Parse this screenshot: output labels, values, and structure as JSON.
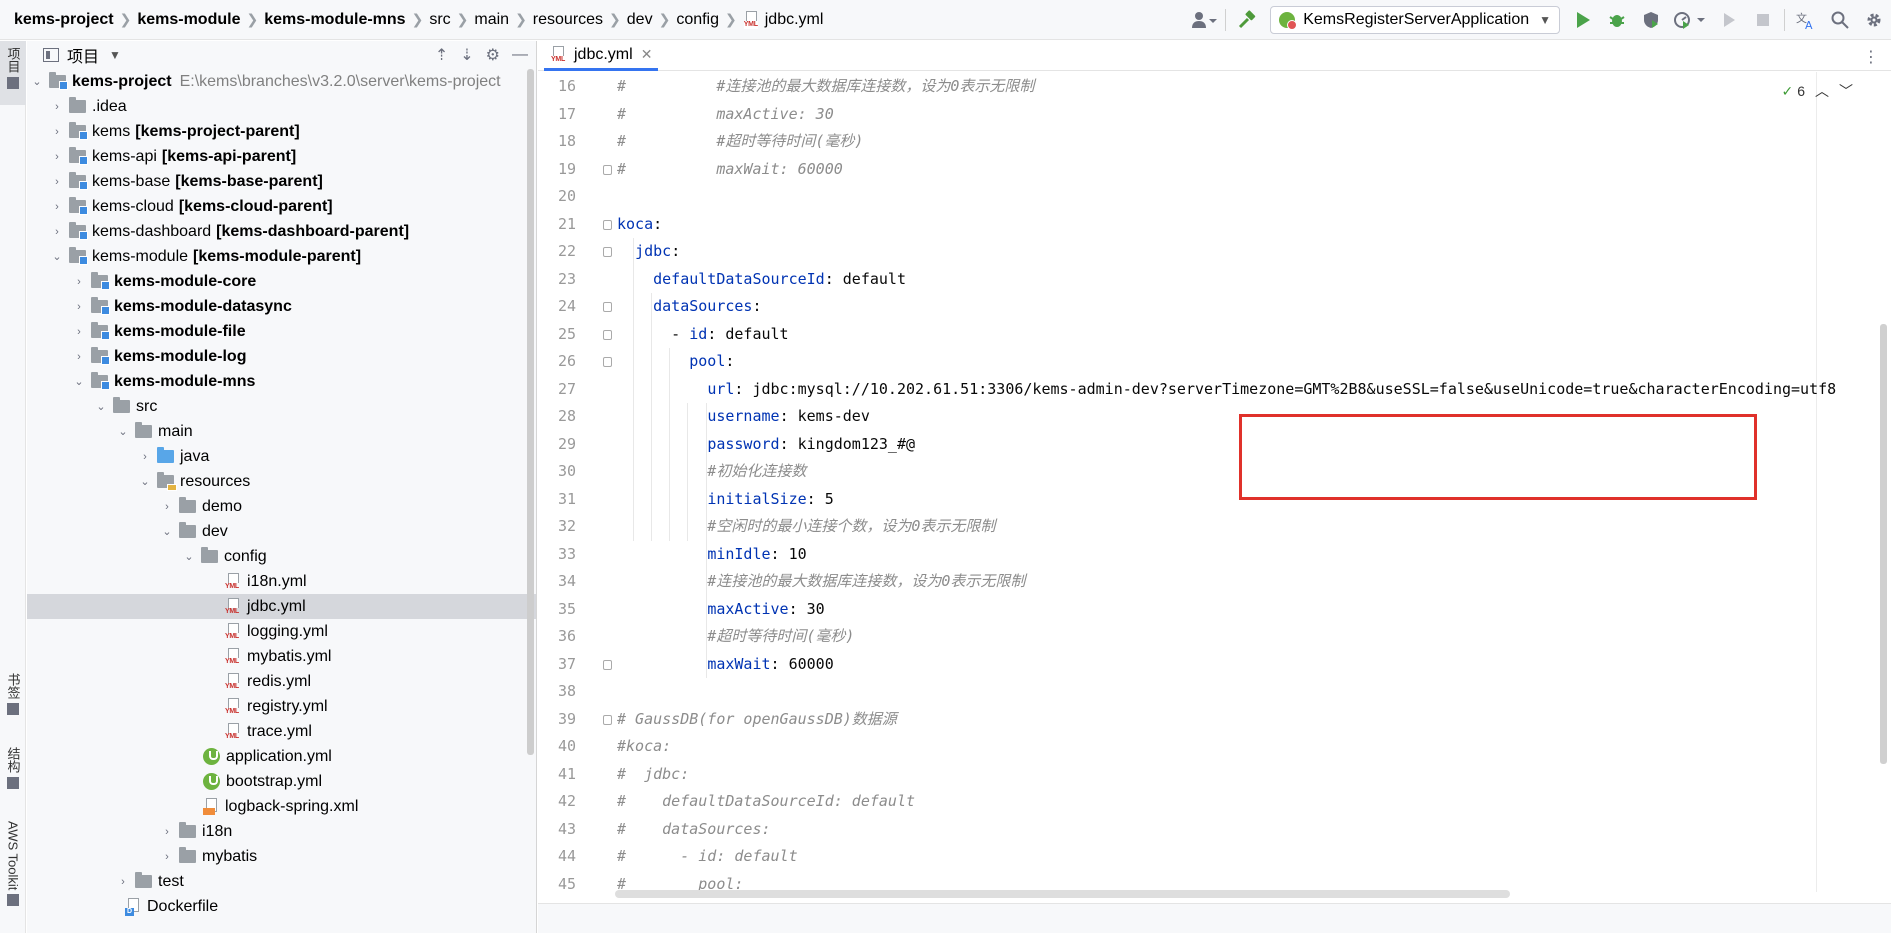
{
  "breadcrumbs": [
    "kems-project",
    "kems-module",
    "kems-module-mns",
    "src",
    "main",
    "resources",
    "dev",
    "config",
    "jdbc.yml"
  ],
  "toolbar": {
    "run_config": "KemsRegisterServerApplication"
  },
  "left_strip": {
    "project": "项目",
    "bookmarks": "书签",
    "structure": "结构",
    "aws": "AWS Toolkit"
  },
  "project_panel": {
    "title": "项目",
    "tree": [
      {
        "label": "kems-project",
        "path": "E:\\kems\\branches\\v3.2.0\\server\\kems-project"
      },
      {
        "label": ".idea"
      },
      {
        "label": "kems",
        "bracket": "[kems-project-parent]"
      },
      {
        "label": "kems-api",
        "bracket": "[kems-api-parent]"
      },
      {
        "label": "kems-base",
        "bracket": "[kems-base-parent]"
      },
      {
        "label": "kems-cloud",
        "bracket": "[kems-cloud-parent]"
      },
      {
        "label": "kems-dashboard",
        "bracket": "[kems-dashboard-parent]"
      },
      {
        "label": "kems-module",
        "bracket": "[kems-module-parent]"
      },
      {
        "label": "kems-module-core"
      },
      {
        "label": "kems-module-datasync"
      },
      {
        "label": "kems-module-file"
      },
      {
        "label": "kems-module-log"
      },
      {
        "label": "kems-module-mns"
      },
      {
        "label": "src"
      },
      {
        "label": "main"
      },
      {
        "label": "java"
      },
      {
        "label": "resources"
      },
      {
        "label": "demo"
      },
      {
        "label": "dev"
      },
      {
        "label": "config"
      },
      {
        "label": "i18n.yml"
      },
      {
        "label": "jdbc.yml"
      },
      {
        "label": "logging.yml"
      },
      {
        "label": "mybatis.yml"
      },
      {
        "label": "redis.yml"
      },
      {
        "label": "registry.yml"
      },
      {
        "label": "trace.yml"
      },
      {
        "label": "application.yml"
      },
      {
        "label": "bootstrap.yml"
      },
      {
        "label": "logback-spring.xml"
      },
      {
        "label": "i18n"
      },
      {
        "label": "mybatis"
      },
      {
        "label": "test"
      },
      {
        "label": "Dockerfile"
      }
    ]
  },
  "editor": {
    "tab_label": "jdbc.yml",
    "inspection_count": "6",
    "line_numbers": [
      "16",
      "17",
      "18",
      "19",
      "20",
      "21",
      "22",
      "23",
      "24",
      "25",
      "26",
      "27",
      "28",
      "29",
      "30",
      "31",
      "32",
      "33",
      "34",
      "35",
      "36",
      "37",
      "38",
      "39",
      "40",
      "41",
      "42",
      "43",
      "44",
      "45"
    ],
    "lines": [
      {
        "n": "16",
        "segs": [
          {
            "t": "#          #连接池的最大数据库连接数，设为0表示无限制",
            "c": "cm"
          }
        ]
      },
      {
        "n": "17",
        "segs": [
          {
            "t": "#          maxActive: 30",
            "c": "cm"
          }
        ]
      },
      {
        "n": "18",
        "segs": [
          {
            "t": "#          #超时等待时间(毫秒)",
            "c": "cm"
          }
        ]
      },
      {
        "n": "19",
        "segs": [
          {
            "t": "#          maxWait: 60000",
            "c": "cm"
          }
        ]
      },
      {
        "n": "20",
        "segs": []
      },
      {
        "n": "21",
        "segs": [
          {
            "t": "koca",
            "c": "k"
          },
          {
            "t": ":",
            "c": "v"
          }
        ]
      },
      {
        "n": "22",
        "segs": [
          {
            "t": "  ",
            "c": "v"
          },
          {
            "t": "jdbc",
            "c": "k"
          },
          {
            "t": ":",
            "c": "v"
          }
        ]
      },
      {
        "n": "23",
        "segs": [
          {
            "t": "    ",
            "c": "v"
          },
          {
            "t": "defaultDataSourceId",
            "c": "k"
          },
          {
            "t": ": default",
            "c": "v"
          }
        ]
      },
      {
        "n": "24",
        "segs": [
          {
            "t": "    ",
            "c": "v"
          },
          {
            "t": "dataSources",
            "c": "k"
          },
          {
            "t": ":",
            "c": "v"
          }
        ]
      },
      {
        "n": "25",
        "segs": [
          {
            "t": "      - ",
            "c": "v"
          },
          {
            "t": "id",
            "c": "k"
          },
          {
            "t": ": default",
            "c": "v"
          }
        ]
      },
      {
        "n": "26",
        "segs": [
          {
            "t": "        ",
            "c": "v"
          },
          {
            "t": "pool",
            "c": "k"
          },
          {
            "t": ":",
            "c": "v"
          }
        ]
      },
      {
        "n": "27",
        "segs": [
          {
            "t": "          ",
            "c": "v"
          },
          {
            "t": "url",
            "c": "k"
          },
          {
            "t": ": jdbc:mysql://10.202.61.51:3306/kems-admin-dev?serverTimezone=GMT%2B8&useSSL=false&useUnicode=true&characterEncoding=utf8",
            "c": "v"
          }
        ]
      },
      {
        "n": "28",
        "segs": [
          {
            "t": "          ",
            "c": "v"
          },
          {
            "t": "username",
            "c": "k"
          },
          {
            "t": ": kems-dev",
            "c": "v"
          }
        ]
      },
      {
        "n": "29",
        "segs": [
          {
            "t": "          ",
            "c": "v"
          },
          {
            "t": "password",
            "c": "k"
          },
          {
            "t": ": kingdom123_#@",
            "c": "v"
          }
        ]
      },
      {
        "n": "30",
        "segs": [
          {
            "t": "          #初始化连接数",
            "c": "cm"
          }
        ]
      },
      {
        "n": "31",
        "segs": [
          {
            "t": "          ",
            "c": "v"
          },
          {
            "t": "initialSize",
            "c": "k"
          },
          {
            "t": ": 5",
            "c": "v"
          }
        ]
      },
      {
        "n": "32",
        "segs": [
          {
            "t": "          #空闲时的最小连接个数，设为0表示无限制",
            "c": "cm"
          }
        ]
      },
      {
        "n": "33",
        "segs": [
          {
            "t": "          ",
            "c": "v"
          },
          {
            "t": "minIdle",
            "c": "k"
          },
          {
            "t": ": 10",
            "c": "v"
          }
        ]
      },
      {
        "n": "34",
        "segs": [
          {
            "t": "          #连接池的最大数据库连接数，设为0表示无限制",
            "c": "cm"
          }
        ]
      },
      {
        "n": "35",
        "segs": [
          {
            "t": "          ",
            "c": "v"
          },
          {
            "t": "maxActive",
            "c": "k"
          },
          {
            "t": ": 30",
            "c": "v"
          }
        ]
      },
      {
        "n": "36",
        "segs": [
          {
            "t": "          #超时等待时间(毫秒)",
            "c": "cm"
          }
        ]
      },
      {
        "n": "37",
        "segs": [
          {
            "t": "          ",
            "c": "v"
          },
          {
            "t": "maxWait",
            "c": "k"
          },
          {
            "t": ": 60000",
            "c": "v"
          }
        ]
      },
      {
        "n": "38",
        "segs": []
      },
      {
        "n": "39",
        "segs": [
          {
            "t": "# GaussDB(for openGaussDB)数据源",
            "c": "cm"
          }
        ]
      },
      {
        "n": "40",
        "segs": [
          {
            "t": "#koca:",
            "c": "cm"
          }
        ]
      },
      {
        "n": "41",
        "segs": [
          {
            "t": "#  jdbc:",
            "c": "cm"
          }
        ]
      },
      {
        "n": "42",
        "segs": [
          {
            "t": "#    defaultDataSourceId: default",
            "c": "cm"
          }
        ]
      },
      {
        "n": "43",
        "segs": [
          {
            "t": "#    dataSources:",
            "c": "cm"
          }
        ]
      },
      {
        "n": "44",
        "segs": [
          {
            "t": "#      - id: default",
            "c": "cm"
          }
        ]
      },
      {
        "n": "45",
        "segs": [
          {
            "t": "#        pool:",
            "c": "cm"
          }
        ]
      }
    ]
  },
  "colors": {
    "highlight_box": "#e0312a",
    "key": "#0033b3",
    "comment": "#8c8c8c",
    "selected_row": "#d5d7dc"
  }
}
